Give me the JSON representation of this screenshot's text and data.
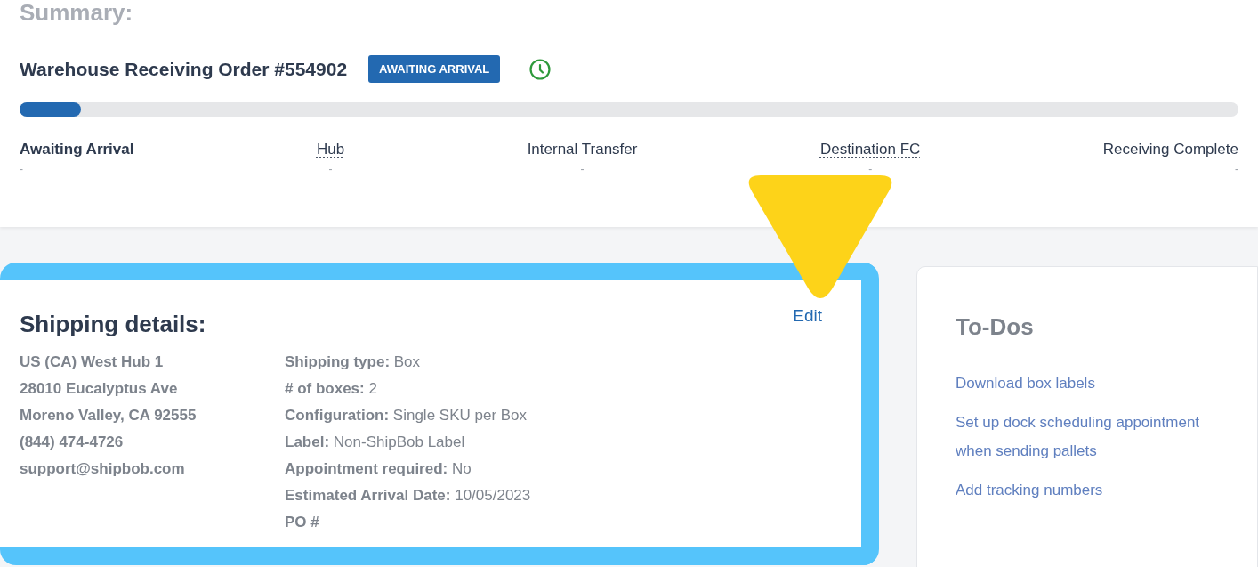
{
  "summary": {
    "heading": "Summary:",
    "order_title": "Warehouse Receiving Order #554902",
    "status_badge": "AWAITING ARRIVAL",
    "progress": {
      "level": 0.05
    },
    "steps": [
      {
        "label": "Awaiting Arrival",
        "value": "-",
        "dotted": false
      },
      {
        "label": "Hub",
        "value": "-",
        "dotted": true
      },
      {
        "label": "Internal Transfer",
        "value": "-",
        "dotted": false
      },
      {
        "label": "Destination FC",
        "value": "-",
        "dotted": true
      },
      {
        "label": "Receiving Complete",
        "value": "-",
        "dotted": false
      }
    ]
  },
  "shipping_details": {
    "title": "Shipping details:",
    "edit_link": "Edit",
    "highlighted": true,
    "address_lines": [
      "US (CA) West Hub 1",
      "28010 Eucalyptus Ave",
      "Moreno Valley, CA 92555",
      "(844) 474-4726",
      "support@shipbob.com"
    ],
    "fields": [
      {
        "label": "Shipping type:",
        "value": "Box"
      },
      {
        "label": "# of boxes:",
        "value": "2"
      },
      {
        "label": "Configuration:",
        "value": "Single SKU per Box"
      },
      {
        "label": "Label:",
        "value": "Non-ShipBob Label"
      },
      {
        "label": "Appointment required:",
        "value": "No"
      },
      {
        "label": "Estimated Arrival Date:",
        "value": "10/05/2023"
      },
      {
        "label": "PO #"
      }
    ]
  },
  "todos": {
    "title": "To-Dos",
    "items": [
      "Download box labels",
      "Set up dock scheduling appointment when sending pallets",
      "Add tracking numbers"
    ]
  }
}
